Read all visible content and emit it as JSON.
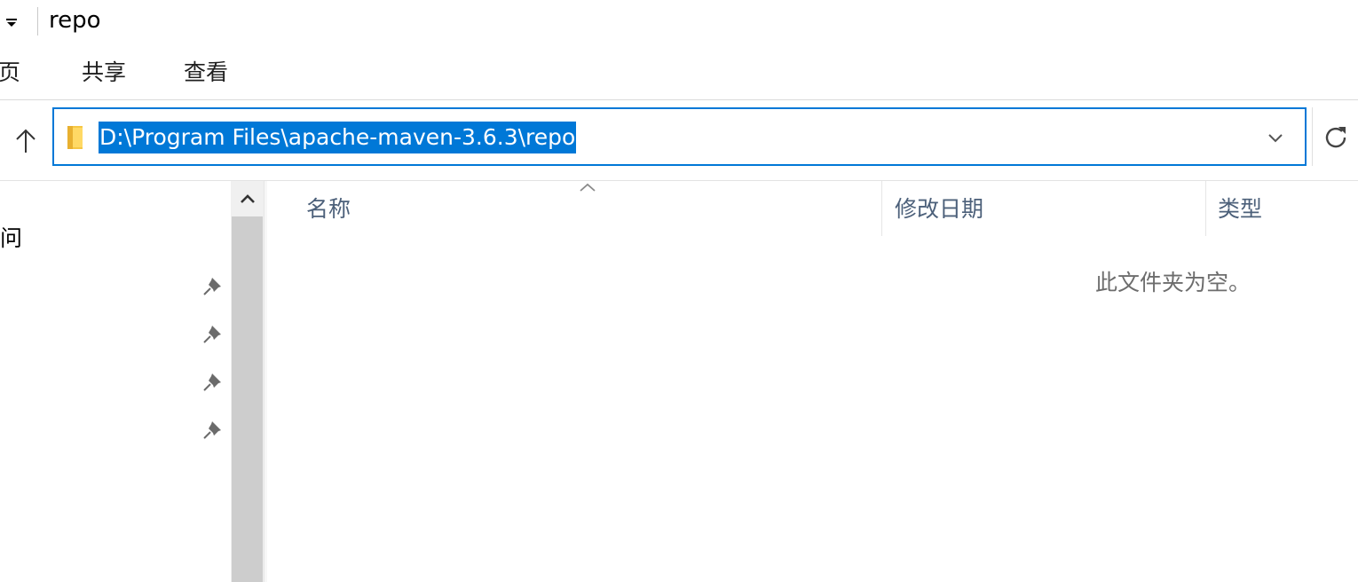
{
  "window": {
    "title": "repo"
  },
  "quick_access_toolbar": {
    "dropdown_icon": "caret-down-icon"
  },
  "ribbon": {
    "tabs": [
      {
        "label": "页"
      },
      {
        "label": "共享"
      },
      {
        "label": "查看"
      }
    ]
  },
  "address_bar": {
    "path": "D:\\Program Files\\apache-maven-3.6.3\\repo",
    "selected": true,
    "accent_color": "#0078d7",
    "icons": {
      "up": "up-arrow-icon",
      "folder": "folder-icon",
      "history": "chevron-down-icon",
      "refresh": "refresh-icon"
    }
  },
  "nav_pane": {
    "partial_label": "问",
    "pinned_icon": "pin-icon",
    "pinned_count": 4
  },
  "file_list": {
    "columns": [
      {
        "label": "名称",
        "sorted": "ascending"
      },
      {
        "label": "修改日期"
      },
      {
        "label": "类型"
      }
    ],
    "empty_message": "此文件夹为空。"
  }
}
